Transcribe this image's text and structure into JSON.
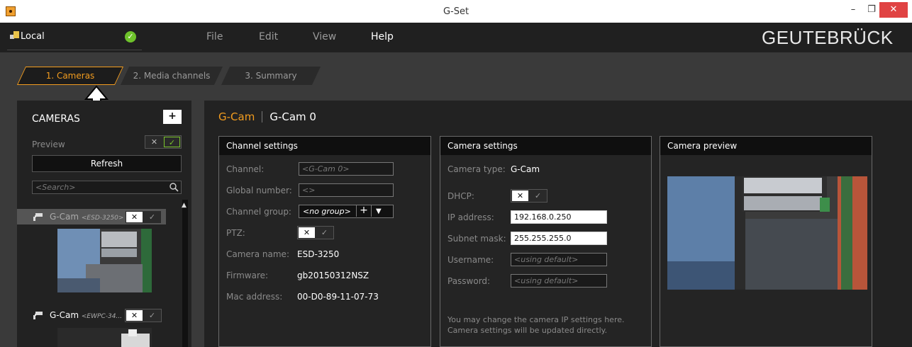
{
  "window": {
    "title": "G-Set"
  },
  "menubar": {
    "connection": "Local",
    "items": [
      "File",
      "Edit",
      "View",
      "Help"
    ],
    "brand": "GEUTEBRÜCK"
  },
  "steps": [
    "1. Cameras",
    "2. Media channels",
    "3. Summary"
  ],
  "left": {
    "title": "CAMERAS",
    "preview_label": "Preview",
    "refresh": "Refresh",
    "search_placeholder": "<Search>",
    "cameras": [
      {
        "name": "G-Cam",
        "sub": "<ESD-3250>"
      },
      {
        "name": "G-Cam",
        "sub": "<EWPC-34..."
      }
    ]
  },
  "main": {
    "crumb_type": "G-Cam",
    "crumb_name": "G-Cam 0",
    "channel": {
      "title": "Channel settings",
      "labels": [
        "Channel:",
        "Global number:",
        "Channel group:",
        "PTZ:",
        "Camera name:",
        "Firmware:",
        "Mac address:"
      ],
      "channel_value": "<G-Cam 0>",
      "global_number_value": "<>",
      "group_value": "<no group>",
      "camera_name": "ESD-3250",
      "firmware": "gb20150312NSZ",
      "mac": "00-D0-89-11-07-73"
    },
    "camera": {
      "title": "Camera settings",
      "labels": [
        "Camera type:",
        "DHCP:",
        "IP address:",
        "Subnet mask:",
        "Username:",
        "Password:"
      ],
      "type": "G-Cam",
      "ip": "192.168.0.250",
      "mask": "255.255.255.0",
      "username_placeholder": "<using default>",
      "password_placeholder": "<using default>",
      "note_line1": "You may change the camera IP settings here.",
      "note_line2": "Camera settings will be updated directly."
    },
    "preview": {
      "title": "Camera preview"
    }
  },
  "icons": {
    "ok": "check-icon",
    "no": "x-icon"
  },
  "colors": {
    "accent": "#f29c1f",
    "ok_green": "#7bc42c",
    "close_red": "#e04343"
  }
}
